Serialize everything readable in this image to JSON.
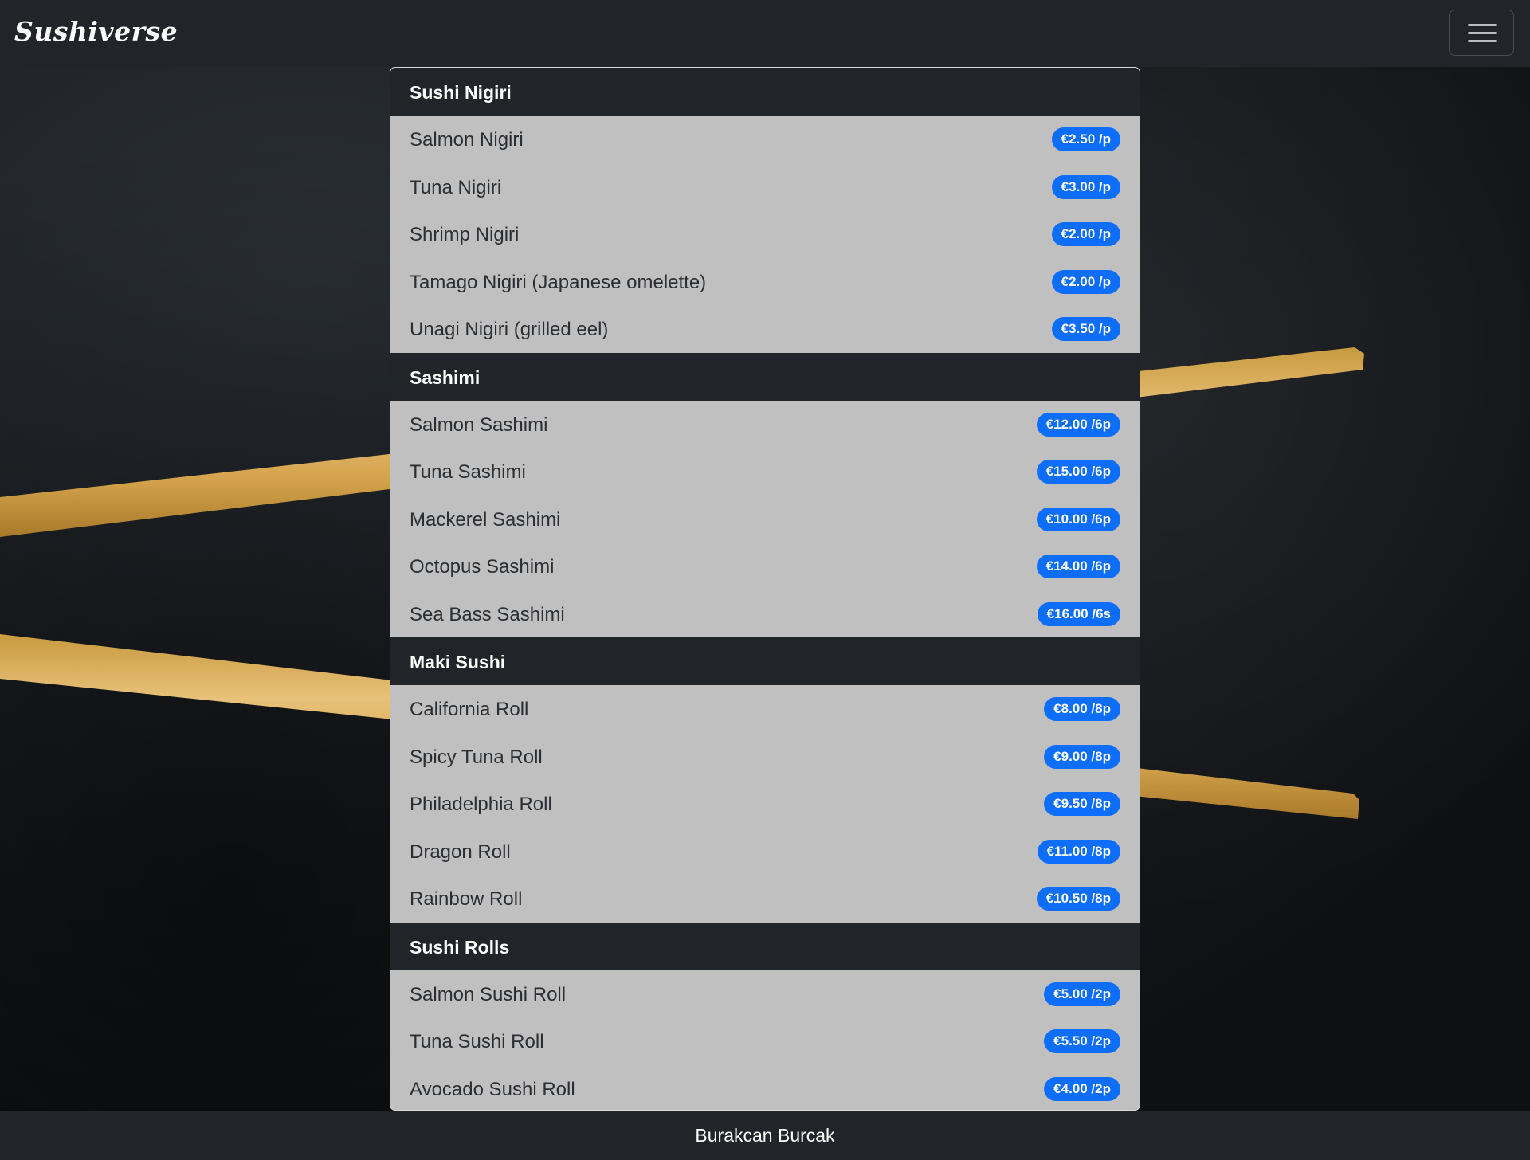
{
  "app": {
    "brand": "Sushiverse",
    "colors": {
      "navbar": "#212529",
      "badge": "#0d6efd",
      "item_bg": "#c0c0c0"
    },
    "icons": {
      "menu": "hamburger-icon"
    }
  },
  "menu": {
    "sections": [
      {
        "title": "Sushi Nigiri",
        "items": [
          {
            "name": "Salmon Nigiri",
            "price": "€2.50 /p"
          },
          {
            "name": "Tuna Nigiri",
            "price": "€3.00 /p"
          },
          {
            "name": "Shrimp Nigiri",
            "price": "€2.00 /p"
          },
          {
            "name": "Tamago Nigiri (Japanese omelette)",
            "price": "€2.00 /p"
          },
          {
            "name": "Unagi Nigiri (grilled eel)",
            "price": "€3.50 /p"
          }
        ]
      },
      {
        "title": "Sashimi",
        "items": [
          {
            "name": "Salmon Sashimi",
            "price": "€12.00 /6p"
          },
          {
            "name": "Tuna Sashimi",
            "price": "€15.00 /6p"
          },
          {
            "name": "Mackerel Sashimi",
            "price": "€10.00 /6p"
          },
          {
            "name": "Octopus Sashimi",
            "price": "€14.00 /6p"
          },
          {
            "name": "Sea Bass Sashimi",
            "price": "€16.00 /6s"
          }
        ]
      },
      {
        "title": "Maki Sushi",
        "items": [
          {
            "name": "California Roll",
            "price": "€8.00 /8p"
          },
          {
            "name": "Spicy Tuna Roll",
            "price": "€9.00 /8p"
          },
          {
            "name": "Philadelphia Roll",
            "price": "€9.50 /8p"
          },
          {
            "name": "Dragon Roll",
            "price": "€11.00 /8p"
          },
          {
            "name": "Rainbow Roll",
            "price": "€10.50 /8p"
          }
        ]
      },
      {
        "title": "Sushi Rolls",
        "items": [
          {
            "name": "Salmon Sushi Roll",
            "price": "€5.00 /2p"
          },
          {
            "name": "Tuna Sushi Roll",
            "price": "€5.50 /2p"
          },
          {
            "name": "Avocado Sushi Roll",
            "price": "€4.00 /2p"
          }
        ]
      }
    ]
  },
  "footer": {
    "text": "Burakcan Burcak"
  }
}
